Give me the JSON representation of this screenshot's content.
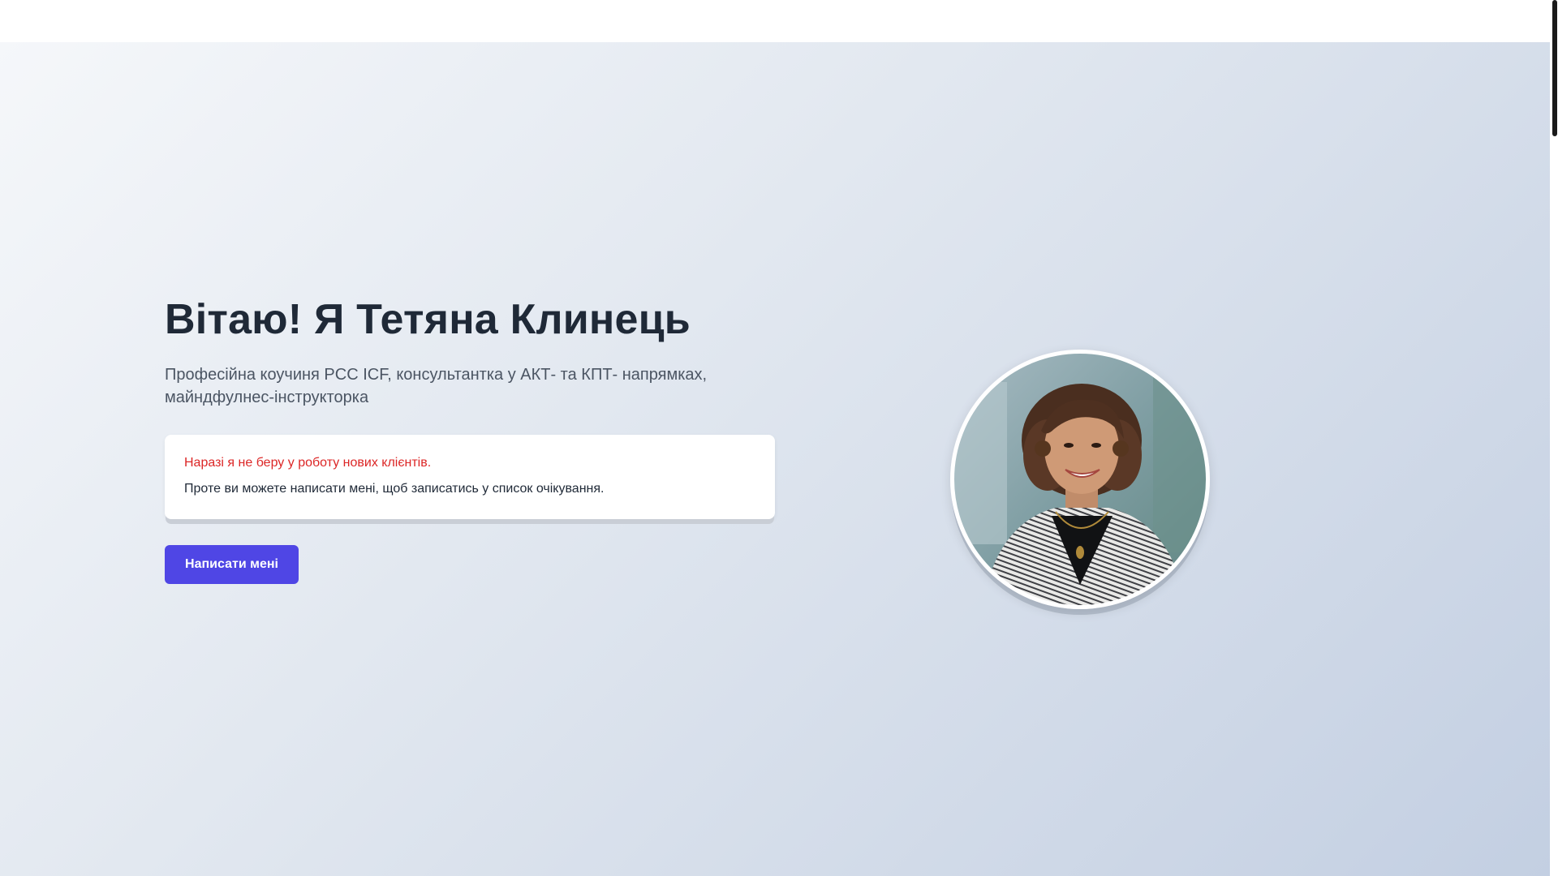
{
  "hero": {
    "title": "Вітаю! Я Тетяна Клинець",
    "subtitle": "Професійна коучиня PCC ICF, консультантка у АКТ- та КПТ- напрямках, майндфулнес-інструкторка"
  },
  "notice": {
    "warning": "Наразі я не беру у роботу нових клієнтів.",
    "text": "Проте ви можете написати мені, щоб записатись у список очікування."
  },
  "cta": {
    "label": "Написати мені"
  },
  "colors": {
    "accent": "#4f46e5",
    "warning": "#dc2626",
    "heading": "#1f2937"
  }
}
